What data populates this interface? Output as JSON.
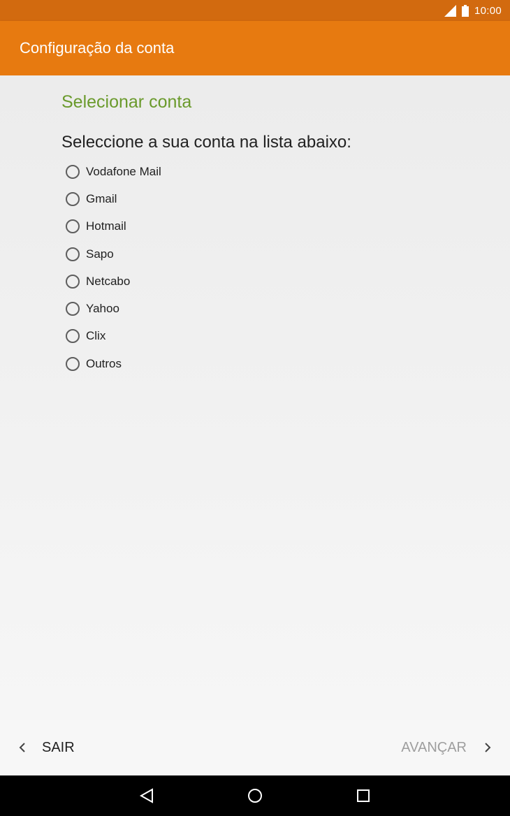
{
  "status_bar": {
    "time": "10:00",
    "icons": [
      "signal-icon",
      "battery-icon"
    ]
  },
  "app_bar": {
    "title": "Configuração da conta",
    "color": "#e77a10",
    "status_color": "#d26a0f"
  },
  "main": {
    "section_title": "Selecionar conta",
    "section_title_color": "#6a9a2c",
    "prompt": "Seleccione a sua conta na lista abaixo:",
    "options": [
      {
        "label": "Vodafone Mail",
        "selected": false
      },
      {
        "label": "Gmail",
        "selected": false
      },
      {
        "label": "Hotmail",
        "selected": false
      },
      {
        "label": "Sapo",
        "selected": false
      },
      {
        "label": "Netcabo",
        "selected": false
      },
      {
        "label": "Yahoo",
        "selected": false
      },
      {
        "label": "Clix",
        "selected": false
      },
      {
        "label": "Outros",
        "selected": false
      }
    ]
  },
  "bottom_bar": {
    "back_label": "SAIR",
    "next_label": "AVANÇAR",
    "back_icon": "chevron-left-icon",
    "next_icon": "chevron-right-icon"
  },
  "system_nav": {
    "buttons": [
      "back-triangle-icon",
      "home-circle-icon",
      "recents-square-icon"
    ]
  }
}
